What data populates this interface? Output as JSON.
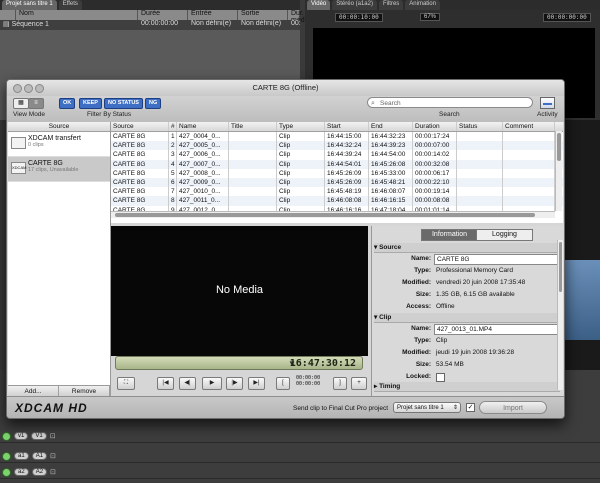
{
  "fcp": {
    "browser_tabs": [
      "Projet sans titre 1",
      "Effets"
    ],
    "browser_cols": [
      "",
      "Nom",
      "Durée",
      "Entrée",
      "Sortie",
      "Dur. média"
    ],
    "sequence_row": {
      "name": "Séquence 1",
      "duration": "00:00:00:00",
      "in": "Non défini(e)",
      "out": "Non défini(e)",
      "media": "00:00:00:00"
    },
    "canvas_tabs": [
      "Vidéo",
      "Stéréo (a1a2)",
      "Filtres",
      "Animation"
    ],
    "canvas_tc": "00:00:10:00",
    "canvas_zoom": "67%",
    "canvas_tc_right": "00:00:00:00",
    "timeline_tracks": [
      {
        "left": "v1",
        "right": "V1"
      },
      {
        "left": "a1",
        "right": "A1"
      },
      {
        "left": "a2",
        "right": "A2"
      }
    ]
  },
  "dialog": {
    "title": "CARTE 8G (Offline)",
    "toolbar": {
      "view_mode_label": "View Mode",
      "filter_label": "Filter By Status",
      "status_buttons": [
        "OK",
        "KEEP",
        "NO STATUS",
        "NG"
      ],
      "search_placeholder": "Search",
      "search_label": "Search",
      "activity_label": "Activity"
    },
    "source_pane": {
      "header": "Source",
      "items": [
        {
          "name": "XDCAM transfert",
          "sub": "0 clips"
        },
        {
          "name": "CARTE 8G",
          "sub": "17 clips, Unavailable"
        }
      ],
      "add_label": "Add...",
      "remove_label": "Remove"
    },
    "table": {
      "columns": [
        "Source",
        "#",
        "Name",
        "Title",
        "Type",
        "Start",
        "End",
        "Duration",
        "Status",
        "Comment"
      ],
      "rows": [
        [
          "CARTE 8G",
          "1",
          "427_0004_0...",
          "",
          "Clip",
          "16:44:15:00",
          "16:44:32:23",
          "00:00:17:24",
          "",
          ""
        ],
        [
          "CARTE 8G",
          "2",
          "427_0005_0...",
          "",
          "Clip",
          "16:44:32:24",
          "16:44:39:23",
          "00:00:07:00",
          "",
          ""
        ],
        [
          "CARTE 8G",
          "3",
          "427_0006_0...",
          "",
          "Clip",
          "16:44:39:24",
          "16:44:54:00",
          "00:00:14:02",
          "",
          ""
        ],
        [
          "CARTE 8G",
          "4",
          "427_0007_0...",
          "",
          "Clip",
          "16:44:54:01",
          "16:45:26:08",
          "00:00:32:08",
          "",
          ""
        ],
        [
          "CARTE 8G",
          "5",
          "427_0008_0...",
          "",
          "Clip",
          "16:45:26:09",
          "16:45:33:00",
          "00:00:06:17",
          "",
          ""
        ],
        [
          "CARTE 8G",
          "6",
          "427_0009_0...",
          "",
          "Clip",
          "16:45:26:09",
          "16:45:48:21",
          "00:00:22:10",
          "",
          ""
        ],
        [
          "CARTE 8G",
          "7",
          "427_0010_0...",
          "",
          "Clip",
          "16:45:48:19",
          "16:46:08:07",
          "00:00:19:14",
          "",
          ""
        ],
        [
          "CARTE 8G",
          "8",
          "427_0011_0...",
          "",
          "Clip",
          "16:46:08:08",
          "16:46:16:15",
          "00:00:08:08",
          "",
          ""
        ],
        [
          "CARTE 8G",
          "9",
          "427_0012_0...",
          "",
          "Clip",
          "16:46:16:16",
          "16:47:18:04",
          "00:01:01:14",
          "",
          ""
        ]
      ]
    },
    "viewer": {
      "no_media": "No Media",
      "timecode": "16:47:30:12",
      "mini_tc": [
        "00:00:00",
        "00:00:00"
      ]
    },
    "info": {
      "tabs": [
        "Information",
        "Logging"
      ],
      "source_header": "Source",
      "source_rows": [
        {
          "label": "Name:",
          "value": "CARTE 8G",
          "field": true
        },
        {
          "label": "Type:",
          "value": "Professional Memory Card"
        },
        {
          "label": "Modified:",
          "value": "vendredi 20 juin 2008 17:35:48"
        },
        {
          "label": "Size:",
          "value": "1.35 GB, 6.15 GB available"
        },
        {
          "label": "Access:",
          "value": "Offline"
        }
      ],
      "clip_header": "Clip",
      "clip_rows": [
        {
          "label": "Name:",
          "value": "427_0013_01.MP4",
          "field": true
        },
        {
          "label": "Type:",
          "value": "Clip"
        },
        {
          "label": "Modified:",
          "value": "jeudi 19 juin 2008 19:36:28"
        },
        {
          "label": "Size:",
          "value": "53.54 MB"
        },
        {
          "label": "Locked:",
          "value": ""
        }
      ],
      "timing_header": "Timing"
    },
    "footer": {
      "logo": "XDCAM HD",
      "send_label": "Send clip to Final Cut Pro project",
      "project_select": "Projet sans titre 1",
      "import_label": "Import"
    }
  }
}
